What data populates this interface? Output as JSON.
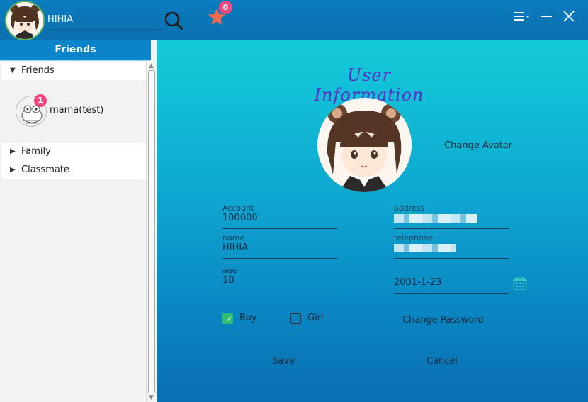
{
  "user": {
    "display_name": "HIHIA"
  },
  "header": {
    "notification_count": "0",
    "icons": [
      "search-icon",
      "star-icon",
      "menu-icon",
      "minimize-icon",
      "close-icon"
    ]
  },
  "sidebar": {
    "title": "Friends",
    "groups": [
      {
        "label": "Friends",
        "expanded": true
      },
      {
        "label": "Family",
        "expanded": false
      },
      {
        "label": "Classmate",
        "expanded": false
      }
    ],
    "friends": [
      {
        "name": "mama(test)",
        "unread": "1"
      }
    ]
  },
  "profile": {
    "title": "User Information",
    "change_avatar_label": "Change Avatar",
    "account": {
      "label": "Account",
      "value": "100000"
    },
    "name": {
      "label": "name",
      "value": "HIHIA"
    },
    "age": {
      "label": "age",
      "value": "18"
    },
    "address": {
      "label": "address"
    },
    "telephone": {
      "label": "telephone"
    },
    "birthday": {
      "value": "2001-1-23"
    },
    "gender": {
      "boy_label": "Boy",
      "girl_label": "Girl",
      "boy_checked": true,
      "girl_checked": false
    },
    "change_password_label": "Change Password",
    "save_label": "Save",
    "cancel_label": "Cancel"
  },
  "colors": {
    "accent_pink": "#f0457e",
    "checkbox_green": "#2fbf71",
    "title_purple": "#5a2ec9",
    "star_orange": "#f26a4b"
  }
}
